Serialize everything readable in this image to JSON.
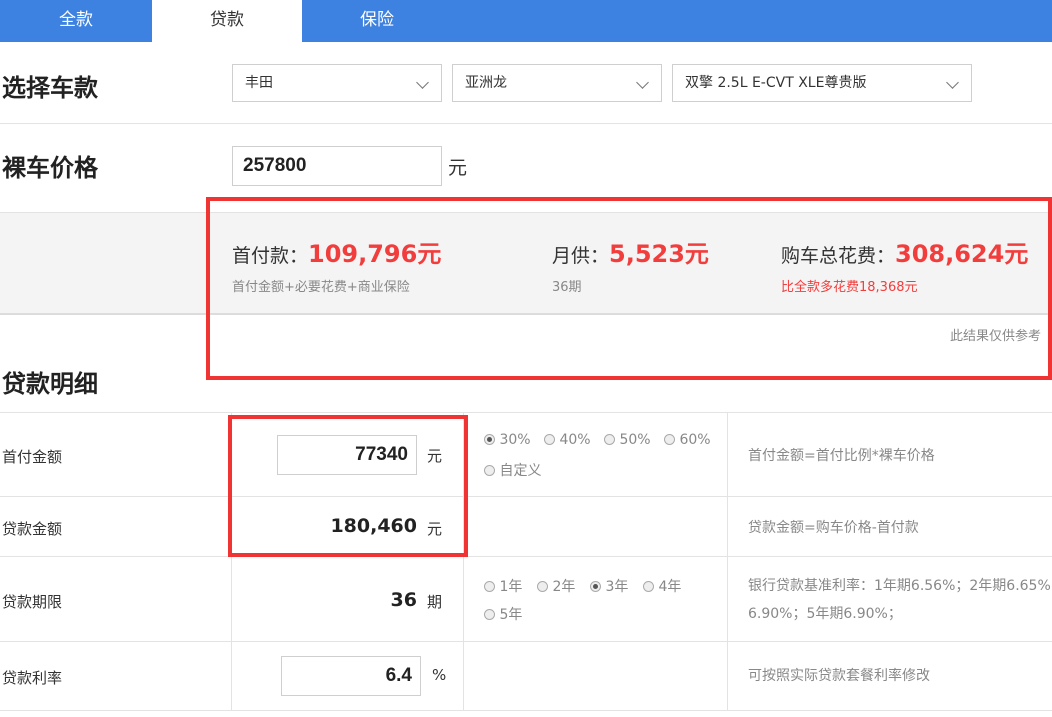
{
  "tabs": [
    {
      "label": "全款"
    },
    {
      "label": "贷款"
    },
    {
      "label": "保险"
    }
  ],
  "select_car": {
    "title": "选择车款",
    "brand": "丰田",
    "model": "亚洲龙",
    "trim": "双擎 2.5L E-CVT XLE尊贵版"
  },
  "price": {
    "title": "裸车价格",
    "value": "257800",
    "unit": "元"
  },
  "result": {
    "down_label": "首付款：",
    "down_value": "109,796元",
    "down_note": "首付金额+必要花费+商业保险",
    "monthly_label": "月供：",
    "monthly_value": "5,523元",
    "monthly_note": "36期",
    "total_label": "购车总花费：",
    "total_value": "308,624元",
    "total_note": "比全款多花费18,368元",
    "disclaimer": "此结果仅供参考"
  },
  "detail": {
    "title": "贷款明细",
    "rows": {
      "down": {
        "label": "首付金额",
        "value": "77340",
        "unit": "元",
        "options": [
          "30%",
          "40%",
          "50%",
          "60%",
          "自定义"
        ],
        "selected": "30%",
        "note": "首付金额=首付比例*裸车价格"
      },
      "loan": {
        "label": "贷款金额",
        "value": "180,460",
        "unit": "元",
        "note": "贷款金额=购车价格-首付款"
      },
      "term": {
        "label": "贷款期限",
        "value": "36",
        "unit": "期",
        "options": [
          "1年",
          "2年",
          "3年",
          "4年",
          "5年"
        ],
        "selected": "3年",
        "note_line1": "银行贷款基准利率：1年期6.56%；2年期6.65%；",
        "note_line2": "6.90%；5年期6.90%；"
      },
      "rate": {
        "label": "贷款利率",
        "value": "6.4",
        "unit": "%",
        "note": "可按照实际贷款套餐利率修改"
      }
    }
  },
  "colors": {
    "tab_blue": "#3d82e0",
    "highlight_red": "#f23d3d",
    "annotation_red": "#f03333"
  }
}
